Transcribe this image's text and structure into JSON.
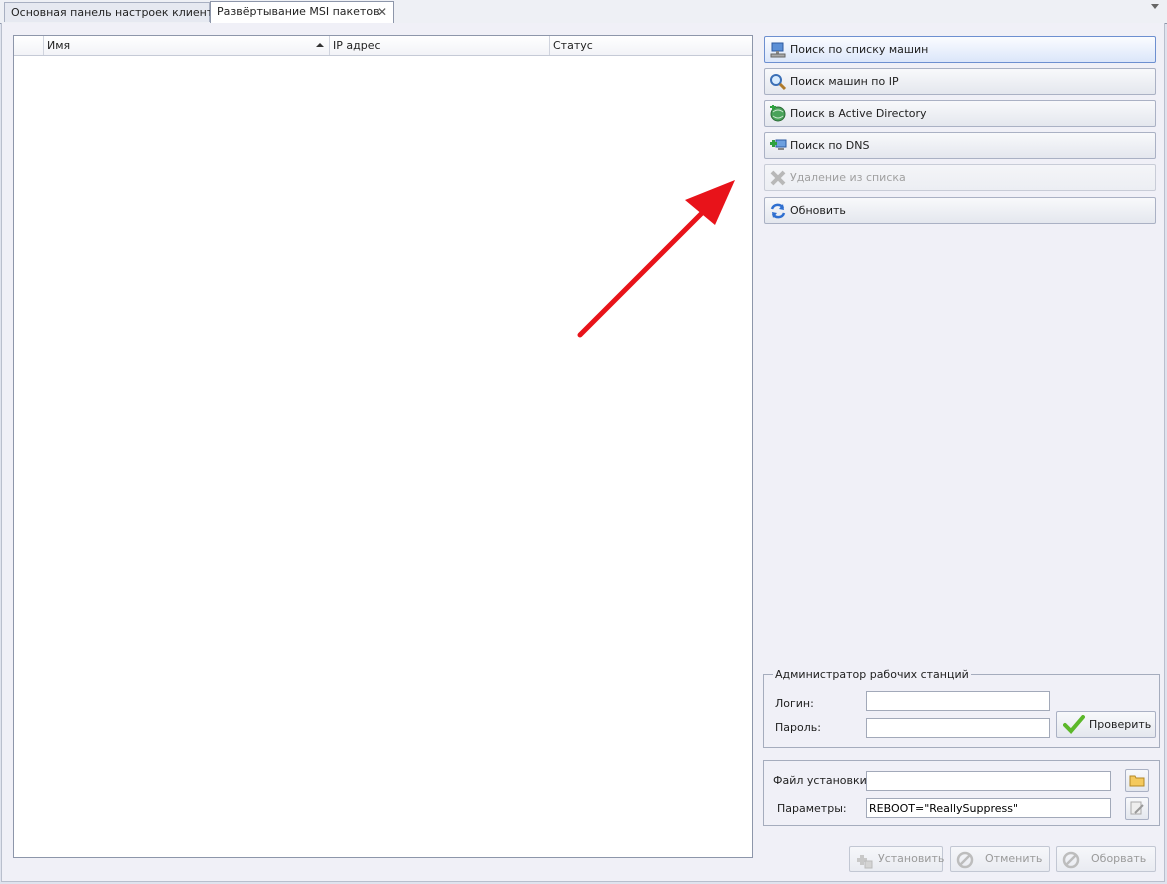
{
  "tabs": [
    {
      "label": "Основная панель настроек клиентов"
    },
    {
      "label": "Развёртывание MSI пакетов",
      "close": "✕"
    }
  ],
  "grid": {
    "columns": [
      "",
      "Имя",
      "IP адрес",
      "Статус"
    ]
  },
  "actions": {
    "search_list": "Поиск по списку машин",
    "search_ip": "Поиск машин по IP",
    "search_ad": "Поиск в Active Directory",
    "search_dns": "Поиск по DNS",
    "remove": "Удаление из списка",
    "refresh": "Обновить"
  },
  "admin": {
    "title": "Администратор рабочих станций",
    "login_label": "Логин:",
    "login_value": "",
    "password_label": "Пароль:",
    "password_value": "",
    "verify_label": "Проверить"
  },
  "install": {
    "file_label": "Файл установки:",
    "file_value": "",
    "params_label": "Параметры:",
    "params_value": "REBOOT=\"ReallySuppress\""
  },
  "bottom": {
    "install": "Установить",
    "cancel": "Отменить",
    "abort": "Оборвать"
  },
  "colors": {
    "annotation_arrow": "#e8131a",
    "accent_border": "#6d8fd0"
  }
}
